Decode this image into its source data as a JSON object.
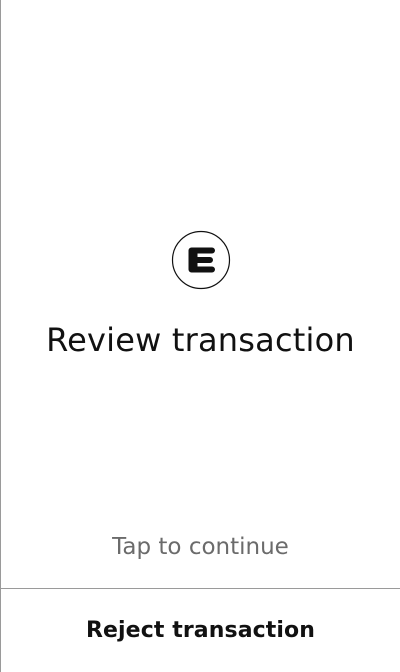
{
  "screen": {
    "logo_icon": "coin-e-logo-icon",
    "title": "Review transaction",
    "hint": "Tap to continue",
    "reject_label": "Reject transaction"
  },
  "colors": {
    "background": "#ffffff",
    "text_primary": "#111111",
    "text_secondary": "#6b6b6b",
    "divider": "#9a9a9a"
  }
}
